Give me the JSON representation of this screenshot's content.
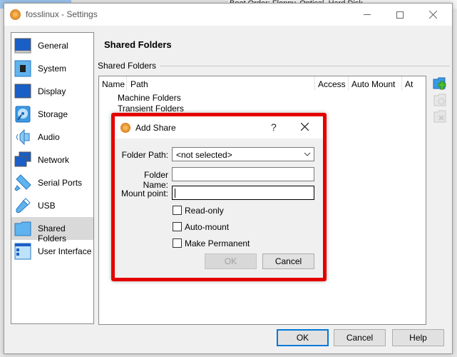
{
  "background": {
    "partial_text": "Boot Order:   Floppy, Optical, Hard Disk"
  },
  "window": {
    "title": "fosslinux - Settings",
    "controls": {
      "minimize": "minimize",
      "maximize": "maximize",
      "close": "close"
    }
  },
  "sidebar": {
    "items": [
      {
        "label": "General",
        "icon": "general-icon",
        "selected": false
      },
      {
        "label": "System",
        "icon": "system-icon",
        "selected": false
      },
      {
        "label": "Display",
        "icon": "display-icon",
        "selected": false
      },
      {
        "label": "Storage",
        "icon": "storage-icon",
        "selected": false
      },
      {
        "label": "Audio",
        "icon": "audio-icon",
        "selected": false
      },
      {
        "label": "Network",
        "icon": "network-icon",
        "selected": false
      },
      {
        "label": "Serial Ports",
        "icon": "serial-ports-icon",
        "selected": false
      },
      {
        "label": "USB",
        "icon": "usb-icon",
        "selected": false
      },
      {
        "label": "Shared Folders",
        "icon": "shared-folders-icon",
        "selected": true
      },
      {
        "label": "User Interface",
        "icon": "user-interface-icon",
        "selected": false
      }
    ]
  },
  "main": {
    "page_title": "Shared Folders",
    "group_label": "Shared Folders",
    "table": {
      "columns": [
        "Name",
        "Path",
        "Access",
        "Auto Mount",
        "At"
      ],
      "rows": [
        "Machine Folders",
        "Transient Folders"
      ]
    },
    "toolbar": {
      "add": "add-shared-folder-icon",
      "edit": "edit-shared-folder-icon",
      "remove": "remove-shared-folder-icon"
    }
  },
  "footer": {
    "ok": "OK",
    "cancel": "Cancel",
    "help": "Help"
  },
  "dialog": {
    "title": "Add Share",
    "help": "?",
    "close": "✕",
    "folder_path_label": "Folder Path:",
    "folder_path_value": "<not selected>",
    "folder_name_label": "Folder Name:",
    "folder_name_value": "",
    "mount_point_label": "Mount point:",
    "mount_point_value": "",
    "checkboxes": [
      {
        "label": "Read-only",
        "checked": false
      },
      {
        "label": "Auto-mount",
        "checked": false
      },
      {
        "label": "Make Permanent",
        "checked": false
      }
    ],
    "ok": "OK",
    "cancel": "Cancel",
    "highlight_color": "#e50000"
  }
}
